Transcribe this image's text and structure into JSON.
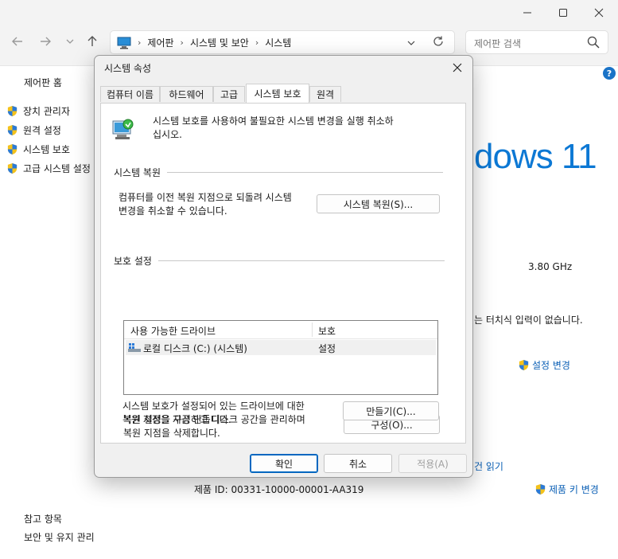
{
  "window": {
    "breadcrumbs": [
      "제어판",
      "시스템 및 보안",
      "시스템"
    ],
    "search_placeholder": "제어판 검색"
  },
  "left_nav": {
    "home": "제어판 홈",
    "items": [
      "장치 관리자",
      "원격 설정",
      "시스템 보호",
      "고급 시스템 설정"
    ],
    "see_also_title": "참고 항목",
    "see_also_items": [
      "보안 및 유지 관리"
    ]
  },
  "background": {
    "logo_text": "dows 11",
    "cpu_speed": "3.80 GHz",
    "touch_text": "는 터치식 입력이 없습니다.",
    "change_settings": "설정 변경",
    "read_terms": "건 읽기",
    "product_id": "제품 ID: 00331-10000-00001-AA319",
    "change_product_key": "제품 키 변경",
    "help": "?"
  },
  "dialog": {
    "title": "시스템 속성",
    "tabs": [
      "컴퓨터 이름",
      "하드웨어",
      "고급",
      "시스템 보호",
      "원격"
    ],
    "active_tab": "시스템 보호",
    "intro_line1": "시스템 보호를 사용하여 불필요한 시스템 변경을 실행 취소하",
    "intro_line2": "십시오.",
    "restore_group": "시스템 복원",
    "restore_desc_line1": "컴퓨터를 이전 복원 지점으로 되돌려 시스템",
    "restore_desc_line2": "변경을 취소할 수 있습니다.",
    "restore_button": "시스템 복원(S)...",
    "protection_group": "보호 설정",
    "columns": [
      "사용 가능한 드라이브",
      "보호"
    ],
    "drives": [
      {
        "name": "로컬 디스크 (C:) (시스템)",
        "protection": "설정"
      }
    ],
    "configure_desc_line1": "복원 설정을 구성하고 디스크 공간을 관리하며",
    "configure_desc_line2": "복원 지점을 삭제합니다.",
    "configure_button": "구성(O)...",
    "create_desc_line1": "시스템 보호가 설정되어 있는 드라이브에 대한",
    "create_desc_line2": "복원 지점을 지금 만듭니다.",
    "create_button": "만들기(C)...",
    "ok_button": "확인",
    "cancel_button": "취소",
    "apply_button": "적용(A)"
  },
  "colors": {
    "accent": "#0067c0",
    "link": "#0a5fb5",
    "windows_blue": "#0c78d4"
  }
}
